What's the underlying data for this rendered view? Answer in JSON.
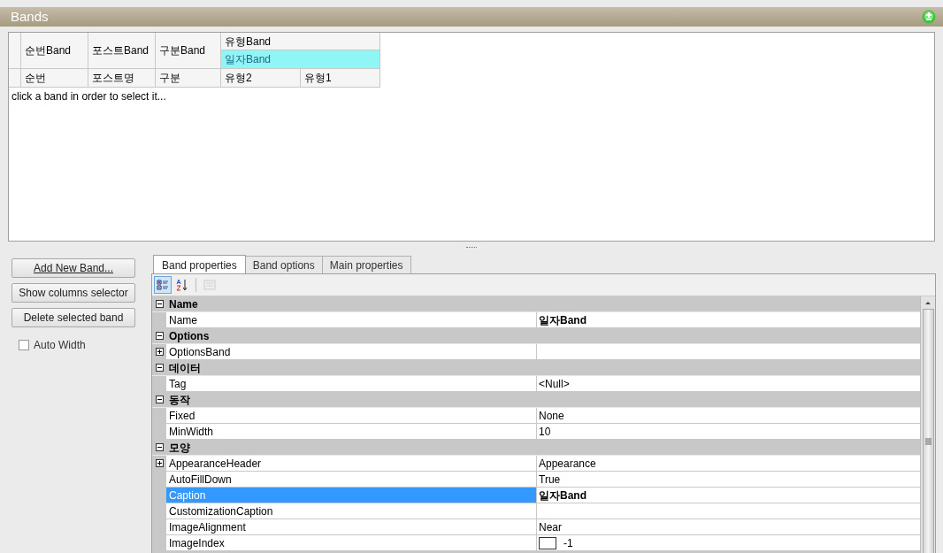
{
  "panel": {
    "title": "Bands"
  },
  "bands": [
    {
      "label": "순번Band",
      "selected": false,
      "columns": [
        "순번"
      ]
    },
    {
      "label": "포스트Band",
      "selected": false,
      "columns": [
        "포스트명"
      ]
    },
    {
      "label": "구분Band",
      "selected": false,
      "columns": [
        "구분"
      ]
    },
    {
      "label": "유형Band",
      "selected": false,
      "children": [
        {
          "label": "일자Band",
          "selected": true,
          "columns": [
            "유형2",
            "유형1"
          ]
        }
      ]
    }
  ],
  "hint": "click a band in order to select it...",
  "buttons": [
    "Add New Band...",
    "Show columns selector",
    "Delete selected band"
  ],
  "auto_width": {
    "label": "Auto Width",
    "checked": false
  },
  "tabs": [
    {
      "label": "Band properties",
      "selected": true
    },
    {
      "label": "Band options",
      "selected": false
    },
    {
      "label": "Main properties",
      "selected": false
    }
  ],
  "toolbar": [
    {
      "kind": "categorized",
      "selected": true,
      "disabled": false
    },
    {
      "kind": "alphabetical",
      "selected": false,
      "disabled": false
    },
    {
      "kind": "pages",
      "selected": false,
      "disabled": true
    }
  ],
  "categories": [
    {
      "name": "Name",
      "expanded": true,
      "properties": [
        {
          "kind": "text",
          "name": "Name",
          "value": "일자Band",
          "expandable": false,
          "selected": false,
          "modified": true
        }
      ]
    },
    {
      "name": "Options",
      "expanded": true,
      "properties": [
        {
          "kind": "text",
          "name": "OptionsBand",
          "expandable": true,
          "selected": false
        }
      ]
    },
    {
      "name": "데이터",
      "expanded": true,
      "properties": [
        {
          "kind": "text",
          "name": "Tag",
          "value": "<Null>",
          "expandable": false,
          "selected": false,
          "modified": false
        }
      ]
    },
    {
      "name": "동작",
      "expanded": true,
      "properties": [
        {
          "kind": "text",
          "name": "Fixed",
          "value": "None",
          "expandable": false,
          "selected": false,
          "modified": false
        },
        {
          "kind": "text",
          "name": "MinWidth",
          "value": "10",
          "expandable": false,
          "selected": false,
          "modified": false
        }
      ]
    },
    {
      "name": "모양",
      "expanded": true,
      "properties": [
        {
          "kind": "text",
          "name": "AppearanceHeader",
          "value": "Appearance",
          "expandable": true,
          "selected": false,
          "modified": false
        },
        {
          "kind": "text",
          "name": "AutoFillDown",
          "value": "True",
          "expandable": false,
          "selected": false,
          "modified": false
        },
        {
          "kind": "text",
          "name": "Caption",
          "value": "일자Band",
          "expandable": false,
          "selected": true,
          "modified": true
        },
        {
          "kind": "text",
          "name": "CustomizationCaption",
          "expandable": false,
          "selected": false
        },
        {
          "kind": "text",
          "name": "ImageAlignment",
          "value": "Near",
          "expandable": false,
          "selected": false,
          "modified": false
        },
        {
          "kind": "image",
          "name": "ImageIndex",
          "value": "-1",
          "expandable": false,
          "selected": false,
          "modified": false
        }
      ]
    }
  ]
}
